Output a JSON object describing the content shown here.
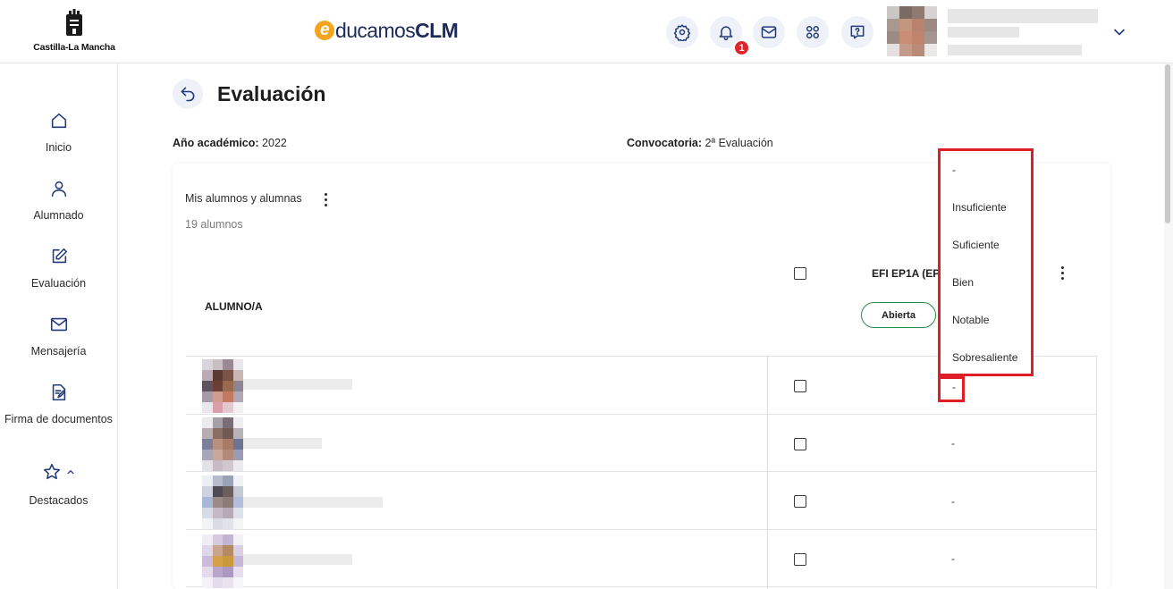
{
  "header": {
    "logo_text": "Castilla-La Mancha",
    "brand": {
      "first_letter": "e",
      "light": "ducamos",
      "bold": "CLM"
    },
    "notification_count": "1",
    "icons": [
      "gear-icon",
      "bell-icon",
      "mail-icon",
      "apps-icon",
      "help-icon",
      "chevron-down-icon"
    ]
  },
  "sidebar": {
    "items": [
      {
        "label": "Inicio",
        "icon": "home-icon"
      },
      {
        "label": "Alumnado",
        "icon": "person-icon"
      },
      {
        "label": "Evaluación",
        "icon": "edit-icon"
      },
      {
        "label": "Mensajería",
        "icon": "mail-icon"
      },
      {
        "label": "Firma de documentos",
        "icon": "document-sign-icon"
      },
      {
        "label": "Destacados",
        "icon": "star-icon"
      }
    ]
  },
  "page": {
    "title": "Evaluación",
    "academic_year_label": "Año académico:",
    "academic_year_value": "2022",
    "call_label": "Convocatoria:",
    "call_value": "2ª Evaluación"
  },
  "list": {
    "title": "Mis alumnos y alumnas",
    "count": "19 alumnos",
    "column_student": "ALUMNO/A",
    "column_subject": "EFI EP1A (EP",
    "status": "Abierta",
    "rows": [
      {
        "grade": "-"
      },
      {
        "grade": "-"
      },
      {
        "grade": "-"
      },
      {
        "grade": "-"
      }
    ]
  },
  "dropdown": {
    "options": [
      "-",
      "Insuficiente",
      "Suficiente",
      "Bien",
      "Notable",
      "Sobresaliente"
    ]
  },
  "colors": {
    "accent": "#233a7a",
    "highlight": "#e01d26",
    "status_border": "#2f8a4a",
    "badge": "#e0252a",
    "brand_orange": "#f3a51f"
  }
}
